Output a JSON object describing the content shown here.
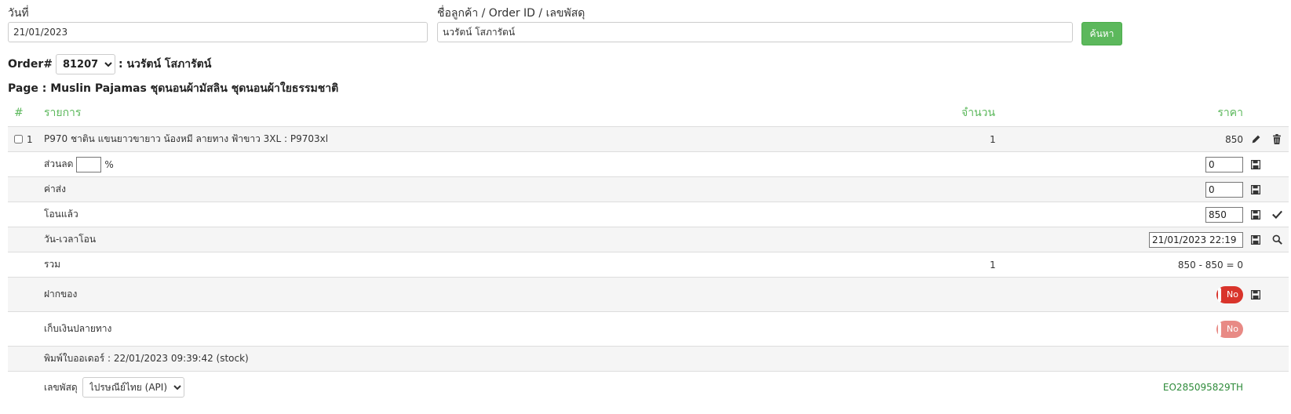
{
  "search": {
    "date_label": "วันที่",
    "date_value": "21/01/2023",
    "customer_label": "ชื่อลูกค้า / Order ID / เลขพัสดุ",
    "customer_value": "นวรัตน์ โสภารัตน์",
    "button_label": "ค้นหา"
  },
  "order": {
    "prefix": "Order#",
    "number": "81207",
    "customer_suffix": ": นวรัตน์ โสภารัตน์",
    "page_text": "Page : Muslin Pajamas ชุดนอนผ้ามัสลิน ชุดนอนผ้าใยธรรมชาติ"
  },
  "table": {
    "headers": {
      "hash": "#",
      "item": "รายการ",
      "qty": "จำนวน",
      "price": "ราคา"
    },
    "item": {
      "index": "1",
      "name": "P970 ชาติน แขนยาวขายาว น้องหมี ลายทาง ฟ้าขาว 3XL : P9703xl",
      "qty": "1",
      "price": "850"
    },
    "discount": {
      "label": "ส่วนลด",
      "percent_sign": "%",
      "value": "0"
    },
    "shipping": {
      "label": "ค่าส่ง",
      "value": "0"
    },
    "transferred": {
      "label": "โอนแล้ว",
      "value": "850"
    },
    "transfer_time": {
      "label": "วัน-เวลาโอน",
      "value": "21/01/2023 22:19"
    },
    "total": {
      "label": "รวม",
      "qty": "1",
      "summary": "850 - 850 = 0"
    },
    "deposit": {
      "label": "ฝากของ",
      "toggle": "No"
    },
    "cod": {
      "label": "เก็บเงินปลายทาง",
      "toggle": "No"
    },
    "print": {
      "text": "พิมพ์ใบออเดอร์ : 22/01/2023 09:39:42 (stock)"
    },
    "tracking": {
      "label": "เลขพัสดุ",
      "courier": "ไปรษณีย์ไทย (API)",
      "number": "EO285095829TH"
    }
  },
  "colors": {
    "accent": "#5cb85c",
    "toggle_on": "#d9342b",
    "toggle_light": "#e88a85",
    "tracking": "#2e8b3a"
  },
  "icons": [
    "pencil-icon",
    "trash-icon",
    "save-icon",
    "check-icon",
    "search-icon",
    "chevron-down-icon"
  ]
}
